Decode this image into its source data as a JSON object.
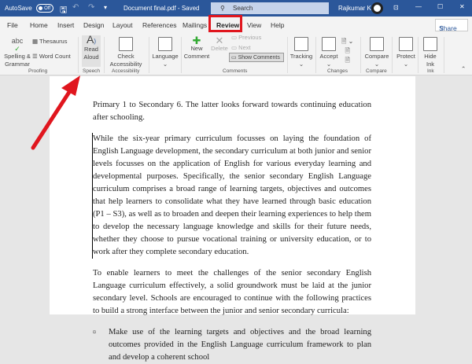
{
  "titlebar": {
    "autosave": "AutoSave",
    "toggle": "Off",
    "doc_title": "Document final.pdf - Saved",
    "search_placeholder": "Search",
    "user": "Rajkumar K"
  },
  "tabs": [
    "File",
    "Home",
    "Insert",
    "Design",
    "Layout",
    "References",
    "Mailings",
    "Review",
    "View",
    "Help"
  ],
  "share": "Share",
  "ribbon": {
    "spelling": "Spelling & Grammar",
    "thesaurus": "Thesaurus",
    "word_count": "Word Count",
    "proofing": "Proofing",
    "read_aloud": "Read Aloud",
    "speech": "Speech",
    "check_accessibility": "Check Accessibility",
    "accessibility": "Accessibility",
    "language": "Language",
    "new_comment": "New Comment",
    "delete": "Delete",
    "previous": "Previous",
    "next": "Next",
    "show_comments": "Show Comments",
    "comments": "Comments",
    "tracking": "Tracking",
    "accept": "Accept",
    "changes": "Changes",
    "compare": "Compare",
    "compare_group": "Compare",
    "protect": "Protect",
    "hide_ink": "Hide Ink",
    "ink": "Ink"
  },
  "document": {
    "p1": "Primary 1 to Secondary 6. The latter looks forward towards continuing education after schooling.",
    "p2": "While the six-year primary curriculum focusses on laying the foundation of English Language development, the secondary curriculum at both junior and senior levels focusses on the application of English for various everyday learning and developmental purposes. Specifically, the senior secondary English Language curriculum comprises a broad range of learning targets, objectives and outcomes that help learners to consolidate what they have learned through basic education (P1 – S3), as well as to broaden and deepen their learning experiences to help them to develop the necessary language knowledge and skills for their future needs, whether they choose to pursue vocational training or university education, or to work after they complete secondary education.",
    "p3": "To enable learners to meet the challenges of the senior secondary English Language curriculum effectively, a solid groundwork must be laid at the junior secondary level. Schools are encouraged to continue with the following practices to build a strong interface between the junior and senior secondary curricula:",
    "bullet_marker": "¤",
    "bullet1": "Make use of the learning targets and objectives and the broad learning outcomes provided in the English Language curriculum framework to plan and develop a coherent school"
  },
  "colors": {
    "titlebar": "#2b579a",
    "highlight": "#e0161e"
  }
}
